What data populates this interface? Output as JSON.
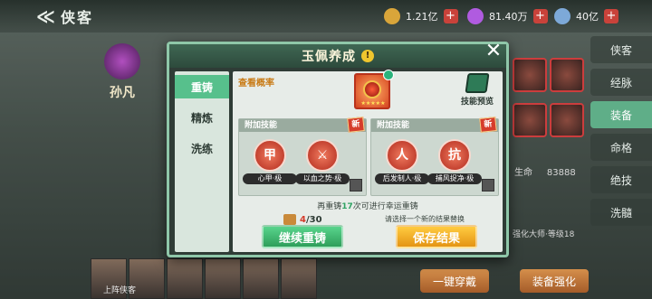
{
  "topbar": {
    "back_title": "侠客",
    "resources": [
      {
        "icon": "gold-coin-icon",
        "value": "1.21亿",
        "color": "#d9a53a"
      },
      {
        "icon": "gem-icon",
        "value": "81.40万",
        "color": "#b05be0"
      },
      {
        "icon": "silver-icon",
        "value": "40亿",
        "color": "#7da9d8"
      }
    ]
  },
  "hero": {
    "name": "孙凡"
  },
  "right_tabs": [
    "侠客",
    "经脉",
    "装备",
    "命格",
    "绝技",
    "洗髓"
  ],
  "side_stats": {
    "hp_label": "生命",
    "hp_value": "83888",
    "master_text": "强化大师·等级18"
  },
  "bottom": {
    "left_btn": "一键穿戴",
    "right_btn": "装备强化",
    "label": "上阵侠客"
  },
  "modal": {
    "title": "玉佩养成",
    "close": "✕",
    "info": "!",
    "menu": [
      "重铸",
      "精炼",
      "洗练"
    ],
    "probability_link": "查看概率",
    "skill_preview": "技能预览",
    "panels": [
      {
        "head": "附加技能",
        "badge": "新",
        "skills": [
          {
            "glyph": "甲",
            "label": "心甲·极"
          },
          {
            "glyph": "⚔",
            "label": "以血之势·极"
          }
        ]
      },
      {
        "head": "附加技能",
        "badge": "新",
        "skills": [
          {
            "glyph": "人",
            "label": "后发制人·极"
          },
          {
            "glyph": "抗",
            "label": "捕风捉净·极"
          }
        ]
      }
    ],
    "note_prefix": "再重铸",
    "note_count": "17",
    "note_suffix": "次可进行幸运重铸",
    "cost": {
      "current": "4",
      "total": "/30"
    },
    "hint": "请选择一个新的结果替换",
    "continue_btn": "继续重铸",
    "save_btn": "保存结果"
  }
}
